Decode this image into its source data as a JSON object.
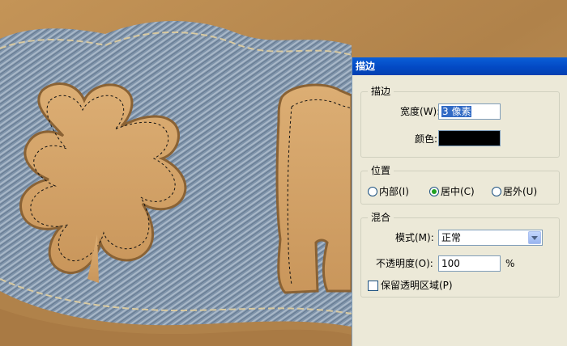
{
  "dialog": {
    "title": "描边",
    "stroke": {
      "group_label": "描边",
      "size_label": "宽度(W):",
      "size_value": "3 像素",
      "color_label": "颜色:",
      "color_value": "#000000"
    },
    "position": {
      "group_label": "位置",
      "options": [
        "内部(I)",
        "居中(C)",
        "居外(U)"
      ],
      "selected": "居中(C)"
    },
    "blend": {
      "group_label": "混合",
      "mode_label": "模式(M):",
      "mode_value": "正常",
      "opacity_label": "不透明度(O):",
      "opacity_value": "100",
      "opacity_unit": "%",
      "preserve_label": "保留透明区域(P)",
      "preserve_checked": false
    }
  }
}
